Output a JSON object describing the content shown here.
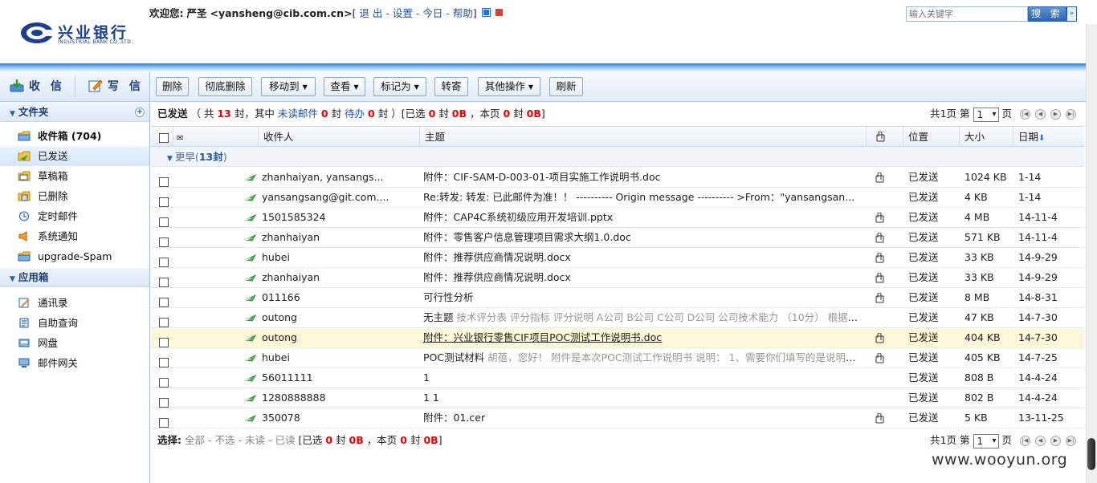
{
  "header": {
    "logo_name": "兴业银行",
    "logo_sub": "INDUSTRIAL BANK CO.,LTD.",
    "welcome_prefix": "欢迎您:",
    "user_name": "严圣",
    "user_email": "<yansheng@cib.com.cn>",
    "bracket_open": "[",
    "links": [
      "退 出",
      "设置",
      "今日",
      "帮助"
    ],
    "link_sep": "-",
    "bracket_close": "]",
    "search_placeholder": "输入关键字",
    "search_label": "搜 索",
    "search_arrow": "»"
  },
  "sidebar": {
    "quick": {
      "receive": "收 信",
      "write": "写 信"
    },
    "folders_title": "文件夹",
    "folders": [
      {
        "label": "收件箱 (704)",
        "icon": "inbox-icon"
      },
      {
        "label": "已发送",
        "icon": "sent-icon"
      },
      {
        "label": "草稿箱",
        "icon": "drafts-icon"
      },
      {
        "label": "已删除",
        "icon": "trash-icon"
      },
      {
        "label": "定时邮件",
        "icon": "clock-icon"
      },
      {
        "label": "系统通知",
        "icon": "speaker-icon"
      },
      {
        "label": "upgrade-Spam",
        "icon": "spam-folder-icon"
      }
    ],
    "apps_title": "应用箱",
    "apps": [
      {
        "label": "通讯录",
        "icon": "address-book-icon"
      },
      {
        "label": "自助查询",
        "icon": "query-icon"
      },
      {
        "label": "网盘",
        "icon": "disk-icon"
      },
      {
        "label": "邮件网关",
        "icon": "gateway-icon"
      }
    ]
  },
  "toolbar": {
    "delete": "删除",
    "purge": "彻底删除",
    "move": "移动到",
    "view": "查看",
    "mark": "标记为",
    "forward": "转寄",
    "other": "其他操作",
    "refresh": "刷新"
  },
  "info": {
    "folder": "已发送",
    "p1": "（ 共",
    "total": "13",
    "p2": "封，其中",
    "unread_label": "未读邮件",
    "unread": "0",
    "p3": "封",
    "pending_label": "待办",
    "pending": "0",
    "p4": "封 ）[已选",
    "sel_count": "0",
    "p5": "封",
    "sel_size": "0B",
    "p6": "，本页",
    "page_count": "0",
    "p7": "封",
    "page_size": "0B",
    "p8": "]"
  },
  "pager": {
    "prefix": "共1页 第",
    "page": "1",
    "suffix": "页"
  },
  "columns": {
    "recipient": "收件人",
    "subject": "主题",
    "location": "位置",
    "size": "大小",
    "date": "日期"
  },
  "group": {
    "label": "更早(",
    "count": "13封",
    "close": ")"
  },
  "emails": [
    {
      "to": "zhanhaiyan, yansangs...",
      "pre": "",
      "subject": "附件：CIF-SAM-D-003-01-项目实施工作说明书.doc",
      "attach": true,
      "loc": "已发送",
      "size": "1024 KB",
      "date": "1-14"
    },
    {
      "to": "yansangsang@git.com....",
      "pre": "",
      "subject": "Re:转发: 转发: 已此邮件为准！！ ---------- Origin message ---------- >From：\"yansangsan...",
      "attach": false,
      "loc": "已发送",
      "size": "4 KB",
      "date": "1-14"
    },
    {
      "to": "1501585324",
      "pre": "",
      "subject": "附件：CAP4C系统初级应用开发培训.pptx",
      "attach": true,
      "loc": "已发送",
      "size": "4 MB",
      "date": "14-11-4"
    },
    {
      "to": "zhanhaiyan",
      "pre": "",
      "subject": "附件：零售客户信息管理项目需求大纲1.0.doc",
      "attach": true,
      "loc": "已发送",
      "size": "571 KB",
      "date": "14-11-4"
    },
    {
      "to": "hubei",
      "pre": "",
      "subject": "附件：推荐供应商情况说明.docx",
      "attach": true,
      "loc": "已发送",
      "size": "33 KB",
      "date": "14-9-29"
    },
    {
      "to": "zhanhaiyan",
      "pre": "",
      "subject": "附件：推荐供应商情况说明.docx",
      "attach": true,
      "loc": "已发送",
      "size": "33 KB",
      "date": "14-9-29"
    },
    {
      "to": "011166",
      "pre": "",
      "subject": "可行性分析",
      "attach": true,
      "loc": "已发送",
      "size": "8 MB",
      "date": "14-8-31"
    },
    {
      "to": "outong",
      "pre": "无主题",
      "subject": " 技术评分表 评分指标 评分说明 A公司 B公司 C公司 D公司 公司技术能力 （10分） 根据公司...",
      "attach": false,
      "loc": "已发送",
      "size": "47 KB",
      "date": "14-7-30"
    },
    {
      "to": "outong",
      "pre": "",
      "subject": "附件：兴业银行零售CIF项目POC测试工作说明书.doc",
      "attach": true,
      "loc": "已发送",
      "size": "404 KB",
      "date": "14-7-30",
      "highlight": true
    },
    {
      "to": "hubei",
      "pre": "POC测试材料",
      "subject": " 胡蓓，您好！ 附件是本次POC测试工作说明书 说明： 1、需要你们填写的是说明书中...",
      "attach": true,
      "loc": "已发送",
      "size": "405 KB",
      "date": "14-7-25"
    },
    {
      "to": "56011111",
      "pre": "",
      "subject": "1",
      "attach": false,
      "loc": "已发送",
      "size": "808 B",
      "date": "14-4-24"
    },
    {
      "to": "1280888888",
      "pre": "",
      "subject": "1 1",
      "attach": false,
      "loc": "已发送",
      "size": "802 B",
      "date": "14-4-24"
    },
    {
      "to": "350078",
      "pre": "",
      "subject": "附件：01.cer",
      "attach": true,
      "loc": "已发送",
      "size": "5 KB",
      "date": "13-11-25"
    }
  ],
  "bottom": {
    "label": "选择:",
    "options": [
      "全部",
      "不选",
      "未读",
      "已读"
    ],
    "sep": "-",
    "p1": "[已选",
    "sel_count": "0",
    "p2": "封",
    "sel_size": "0B",
    "p3": "，本页",
    "page_count": "0",
    "p4": "封",
    "page_size": "0B",
    "p5": "]"
  },
  "watermark": "www.wooyun.org",
  "colors": {
    "accent": "#1f55a8",
    "stripe": "#2f7fd3",
    "alert": "#e00000",
    "highlight_row": "#fdf8d9"
  }
}
